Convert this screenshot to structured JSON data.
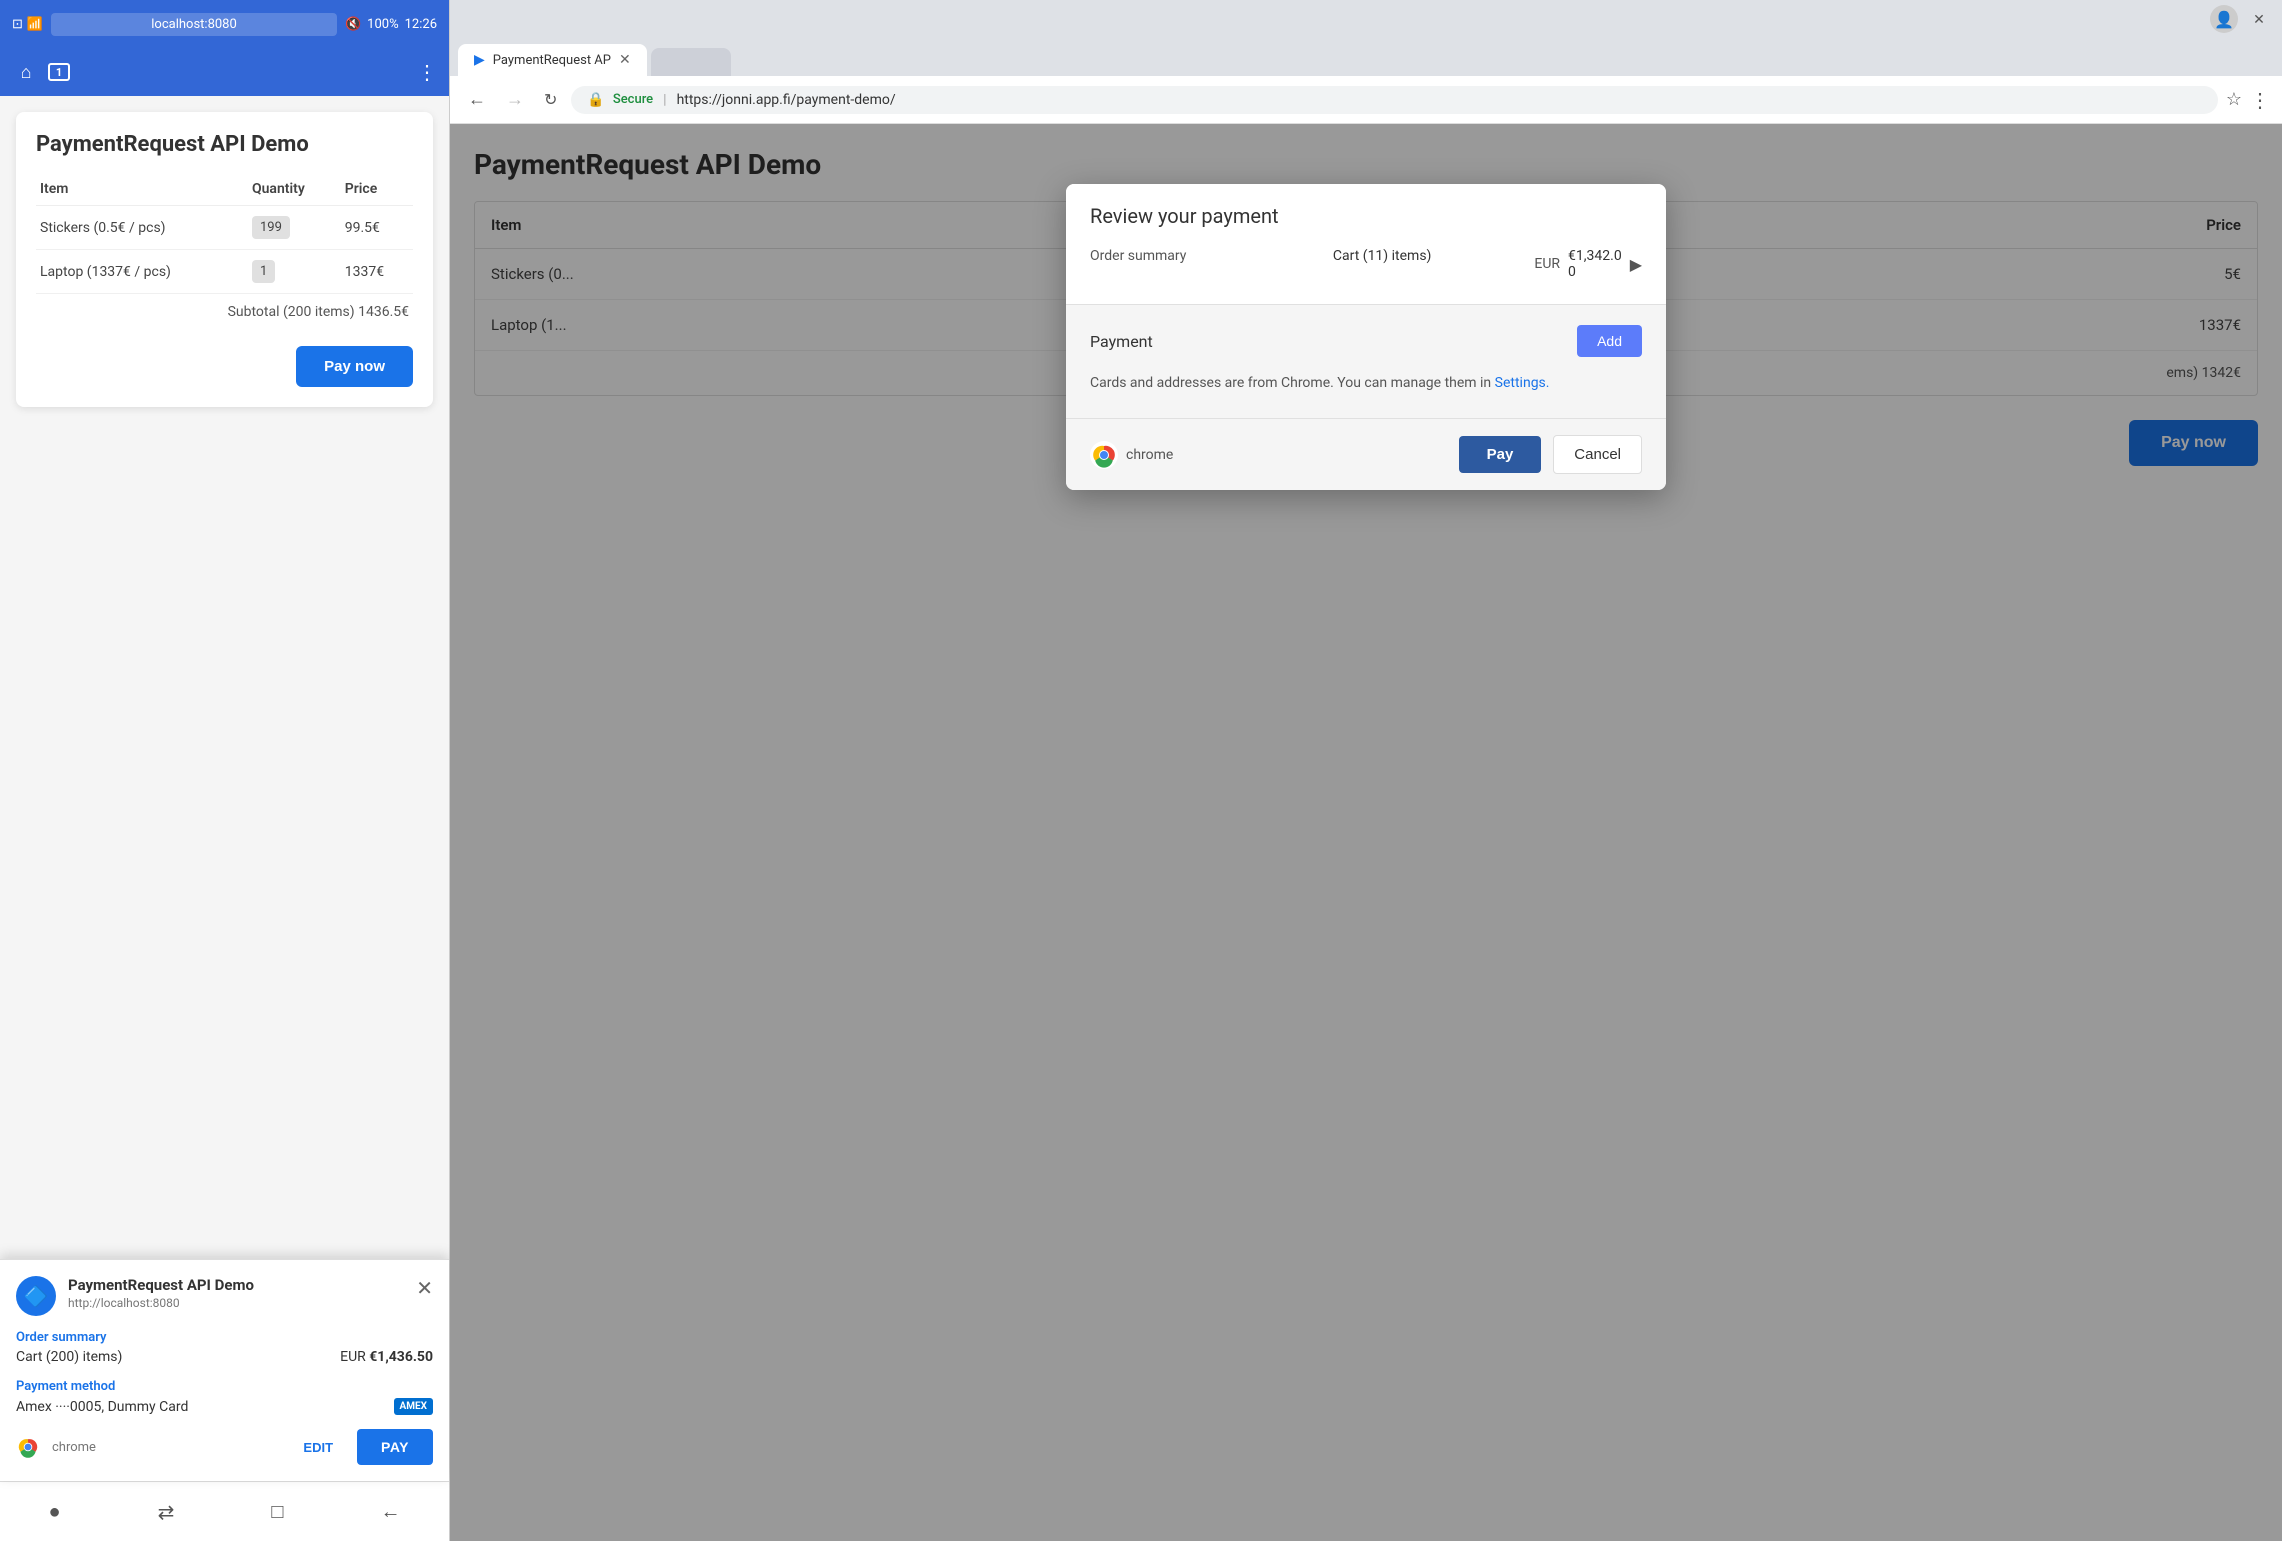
{
  "phone": {
    "status_bar": {
      "time": "12:26",
      "battery": "100%",
      "signal": "4G"
    },
    "browser_bar": {
      "url": "localhost:8080",
      "tab_count": "1"
    },
    "web_page": {
      "title": "PaymentRequest API Demo",
      "table": {
        "headers": [
          "Item",
          "Quantity",
          "Price"
        ],
        "rows": [
          {
            "item": "Stickers (0.5€ / pcs)",
            "quantity": "199",
            "price": "99.5€"
          },
          {
            "item": "Laptop (1337€ / pcs)",
            "quantity": "1",
            "price": "1337€"
          }
        ],
        "subtotal": "Subtotal (200 items) 1436.5€"
      },
      "pay_button": "Pay now"
    },
    "payment_sheet": {
      "app_title": "PaymentRequest API Demo",
      "app_url": "http://localhost:8080",
      "order_summary_label": "Order summary",
      "cart_items": "Cart (200) items)",
      "currency": "EUR",
      "total": "€1,436.50",
      "payment_method_label": "Payment method",
      "payment_method": "Amex ····0005, Dummy Card",
      "chrome_text": "chrome",
      "edit_button": "EDIT",
      "pay_button": "PAY"
    },
    "nav_bar": {
      "icons": [
        "●",
        "⇄",
        "□",
        "←"
      ]
    }
  },
  "desktop": {
    "window": {
      "profile_icon": "👤",
      "close_icon": "✕"
    },
    "tab": {
      "label": "PaymentRequest AP",
      "favicon": "▶"
    },
    "address_bar": {
      "back_icon": "←",
      "forward_icon": "→",
      "refresh_icon": "↻",
      "secure_text": "Secure",
      "url": "https://jonni.app.fi/payment-demo/",
      "star_icon": "☆",
      "menu_icon": "⋮"
    },
    "web_page": {
      "title": "PaymentRequest API Demo",
      "table": {
        "headers": [
          "Item",
          "Price"
        ],
        "rows": [
          {
            "item": "Stickers (0...",
            "price": "5€"
          },
          {
            "item": "Laptop (1...",
            "price": "1337€"
          }
        ],
        "subtotal": "ems) 1342€"
      },
      "pay_button": "Pay now"
    },
    "dialog": {
      "title": "Review your payment",
      "order_summary_label": "Order summary",
      "cart_items": "Cart (11) items)",
      "currency": "EUR",
      "amount": "€1,342.0",
      "amount_line2": "0",
      "expand_icon": "▶",
      "payment_label": "Payment",
      "add_button": "Add",
      "notice_text": "Cards and addresses are from Chrome. You can manage them in",
      "settings_link": "Settings.",
      "chrome_brand": "chrome",
      "pay_button": "Pay",
      "cancel_button": "Cancel"
    }
  }
}
